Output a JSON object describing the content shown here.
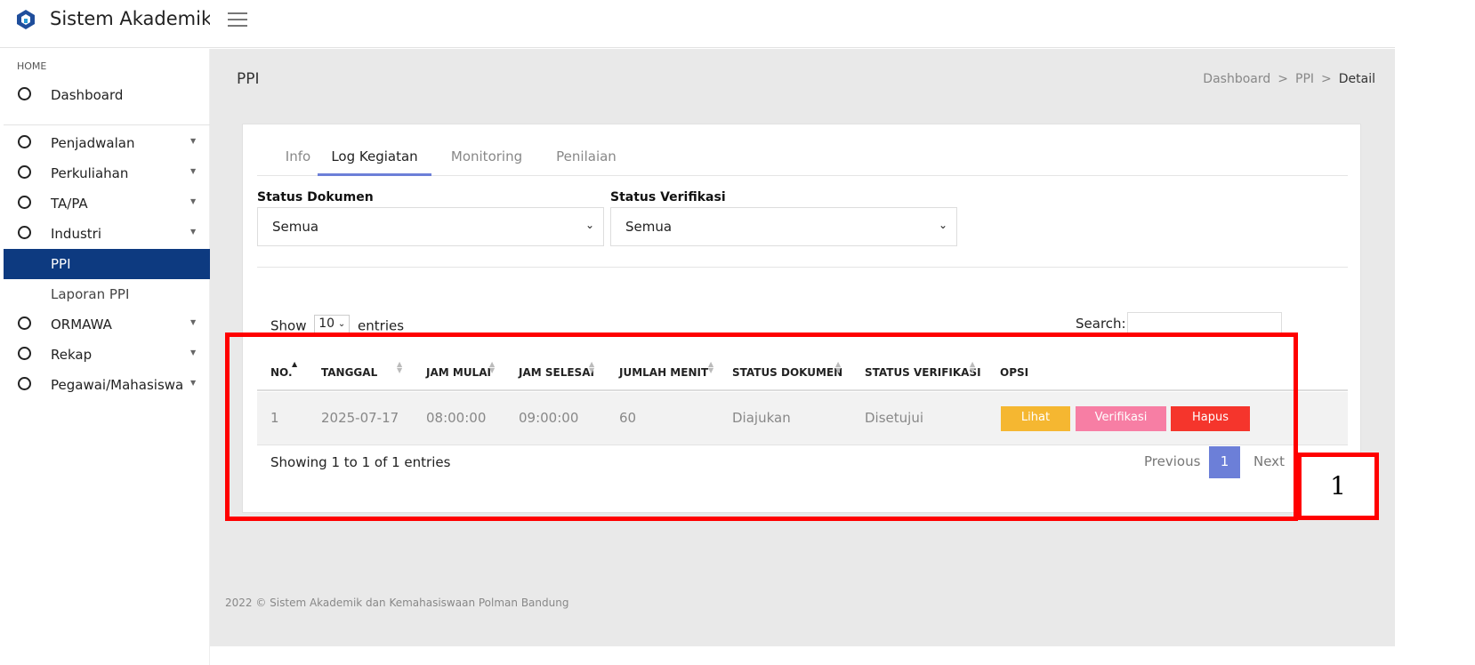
{
  "app": {
    "title": "Sistem Akademik"
  },
  "sidebar": {
    "heading": "HOME",
    "items": [
      {
        "label": "Dashboard"
      },
      {
        "label": "Penjadwalan"
      },
      {
        "label": "Perkuliahan"
      },
      {
        "label": "TA/PA"
      },
      {
        "label": "Industri"
      },
      {
        "label": "PPI"
      },
      {
        "label": "Laporan PPI"
      },
      {
        "label": "ORMAWA"
      },
      {
        "label": "Rekap"
      },
      {
        "label": "Pegawai/Mahasiswa"
      }
    ]
  },
  "page": {
    "title": "PPI",
    "breadcrumb": [
      "Dashboard",
      "PPI",
      "Detail"
    ]
  },
  "tabs": [
    "Info",
    "Log Kegiatan",
    "Monitoring",
    "Penilaian"
  ],
  "filters": {
    "status_dokumen": {
      "label": "Status Dokumen",
      "value": "Semua"
    },
    "status_verifikasi": {
      "label": "Status Verifikasi",
      "value": "Semua"
    }
  },
  "table": {
    "show_label": "Show",
    "entries_value": "10",
    "entries_label": "entries",
    "search_label": "Search:",
    "columns": [
      "NO.",
      "TANGGAL",
      "JAM MULAI",
      "JAM SELESAI",
      "JUMLAH MENIT",
      "STATUS DOKUMEN",
      "STATUS VERIFIKASI",
      "OPSI"
    ],
    "rows": [
      {
        "no": "1",
        "tanggal": "2025-07-17",
        "jam_mulai": "08:00:00",
        "jam_selesai": "09:00:00",
        "jumlah_menit": "60",
        "status_dokumen": "Diajukan",
        "status_verifikasi": "Disetujui"
      }
    ],
    "actions": {
      "lihat": "Lihat",
      "verifikasi": "Verifikasi",
      "hapus": "Hapus"
    },
    "info": "Showing 1 to 1 of 1 entries",
    "pagination": {
      "previous": "Previous",
      "current": "1",
      "next": "Next"
    }
  },
  "footer": "2022 © Sistem Akademik dan Kemahasiswaan Polman Bandung",
  "annotation": {
    "label": "1"
  },
  "colors": {
    "sidebar_active": "#0d3a80",
    "tab_active": "#6c7fd8",
    "btn_lihat": "#f5b731",
    "btn_verifikasi": "#f77ea4",
    "btn_hapus": "#f5352c",
    "annotation": "#ff0000"
  }
}
